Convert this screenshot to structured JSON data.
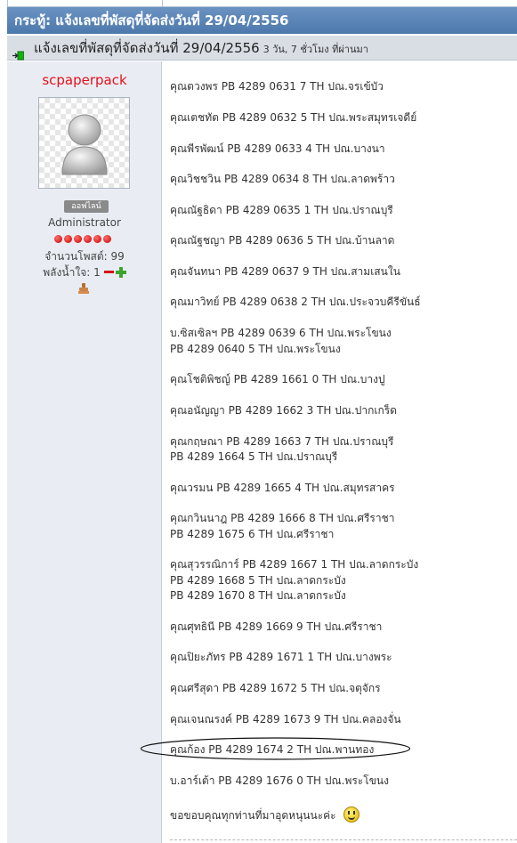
{
  "board": {
    "title": "กระทู้: แจ้งเลขที่พัสดุที่จัดส่งวันที่ 29/04/2556"
  },
  "post": {
    "title": "แจ้งเลขที่พัสดุที่จัดส่งวันที่ 29/04/2556",
    "time_ago": "3 วัน, 7 ชั่วโมง ที่ผ่านมา",
    "lines": [
      "คุณตวงพร PB 4289 0631 7 TH ปณ.จรเข้บัว",
      "คุณเตชทัต PB 4289 0632 5 TH ปณ.พระสมุทรเจดีย์",
      "คุณพีรพัฒน์ PB 4289 0633 4 TH ปณ.บางนา",
      "คุณวิชชวิน PB 4289 0634 8 TH ปณ.ลาดพร้าว",
      "คุณณัฐธิดา PB 4289 0635 1 TH ปณ.ปราณบุรี",
      "คุณณัฐชญา PB 4289 0636 5 TH ปณ.บ้านลาด",
      "คุณจันทนา PB 4289 0637 9 TH ปณ.สามเสนใน",
      "คุณมาวิทย์ PB 4289 0638 2 TH ปณ.ประจวบคีรีขันธ์",
      "บ.ซิสเซิลฯ PB 4289 0639 6 TH ปณ.พระโขนง",
      "PB 4289 0640 5 TH ปณ.พระโขนง",
      "คุณโชติพิชญ์ PB 4289 1661 0 TH ปณ.บางปู",
      "คุณอนัญญา PB 4289 1662 3 TH ปณ.ปากเกร็ด",
      "คุณกฤษณา PB 4289 1663 7 TH ปณ.ปราณบุรี",
      "PB 4289 1664 5 TH ปณ.ปราณบุรี",
      "คุณวรมน PB 4289 1665 4 TH ปณ.สมุทรสาคร",
      "คุณกวินนาฎ PB 4289 1666 8 TH ปณ.ศรีราชา",
      "PB 4289 1675 6 TH ปณ.ศรีราชา",
      "คุณสุวรรณิการ์ PB 4289 1667 1 TH ปณ.ลาดกระบัง",
      "PB 4289 1668 5 TH ปณ.ลาดกระบัง",
      "PB 4289 1670 8 TH ปณ.ลาดกระบัง",
      "คุณศุทธินี PB 4289 1669 9 TH ปณ.ศรีราชา",
      "คุณปิยะภัทร PB 4289 1671 1 TH ปณ.บางพระ",
      "คุณศรีสุดา PB 4289 1672 5 TH ปณ.จตุจักร",
      "คุณเจนณรงค์ PB 4289 1673 9 TH ปณ.คลองจั่น",
      "คุณก้อง PB 4289 1674 2 TH ปณ.พานทอง",
      "บ.อาร์เต้า PB 4289 1676 0 TH ปณ.พระโขนง",
      "ขอขอบคุณทุกท่านที่มาอุดหนุนนะค่ะ"
    ]
  },
  "author": {
    "username": "scpaperpack",
    "status": "ออฟไลน์",
    "role": "Administrator",
    "rank_stars": 6,
    "post_count": "จำนวนโพสต์: 99",
    "karma": "พลังน้ำใจ: 1"
  },
  "colors": {
    "header_blue": "#5b86b8",
    "username_red": "#e8101a"
  },
  "icons": {
    "post_icon": "green-arrow-icon",
    "smiley": "smiley-icon",
    "stamp": "stamp-icon"
  }
}
